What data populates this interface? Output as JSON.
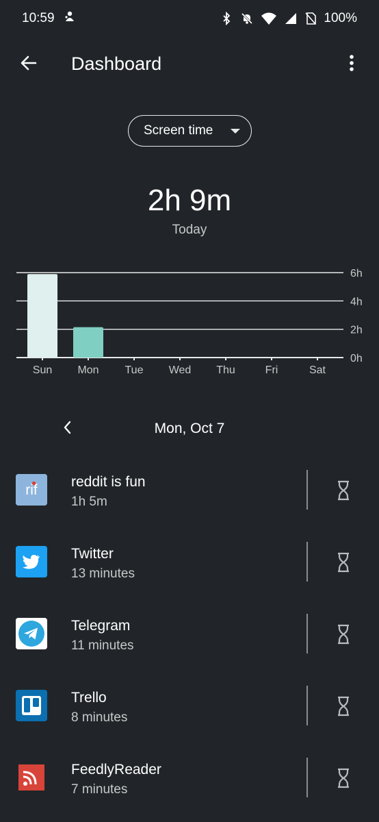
{
  "status_bar": {
    "time": "10:59",
    "battery": "100%"
  },
  "app_bar": {
    "title": "Dashboard",
    "back_icon": "arrow-left-icon",
    "menu_icon": "more-vert-icon"
  },
  "selector": {
    "label": "Screen time"
  },
  "summary": {
    "total": "2h 9m",
    "period": "Today"
  },
  "chart_data": {
    "type": "bar",
    "categories": [
      "Sun",
      "Mon",
      "Tue",
      "Wed",
      "Thu",
      "Fri",
      "Sat"
    ],
    "values": [
      5.9,
      2.15,
      0,
      0,
      0,
      0,
      0
    ],
    "y_ticks": [
      "6h",
      "4h",
      "2h",
      "0h"
    ],
    "ylim": [
      0,
      6
    ],
    "grid": true,
    "colors": [
      "#dff0ee",
      "#7fcfc3"
    ]
  },
  "date_nav": {
    "label": "Mon, Oct 7",
    "prev_icon": "chevron-left-icon"
  },
  "apps": [
    {
      "name": "reddit is fun",
      "time": "1h 5m",
      "icon": "reddit-is-fun-icon",
      "icon_text": "rif"
    },
    {
      "name": "Twitter",
      "time": "13 minutes",
      "icon": "twitter-icon"
    },
    {
      "name": "Telegram",
      "time": "11 minutes",
      "icon": "telegram-icon"
    },
    {
      "name": "Trello",
      "time": "8 minutes",
      "icon": "trello-icon"
    },
    {
      "name": "FeedlyReader",
      "time": "7 minutes",
      "icon": "feedly-reader-icon"
    }
  ]
}
